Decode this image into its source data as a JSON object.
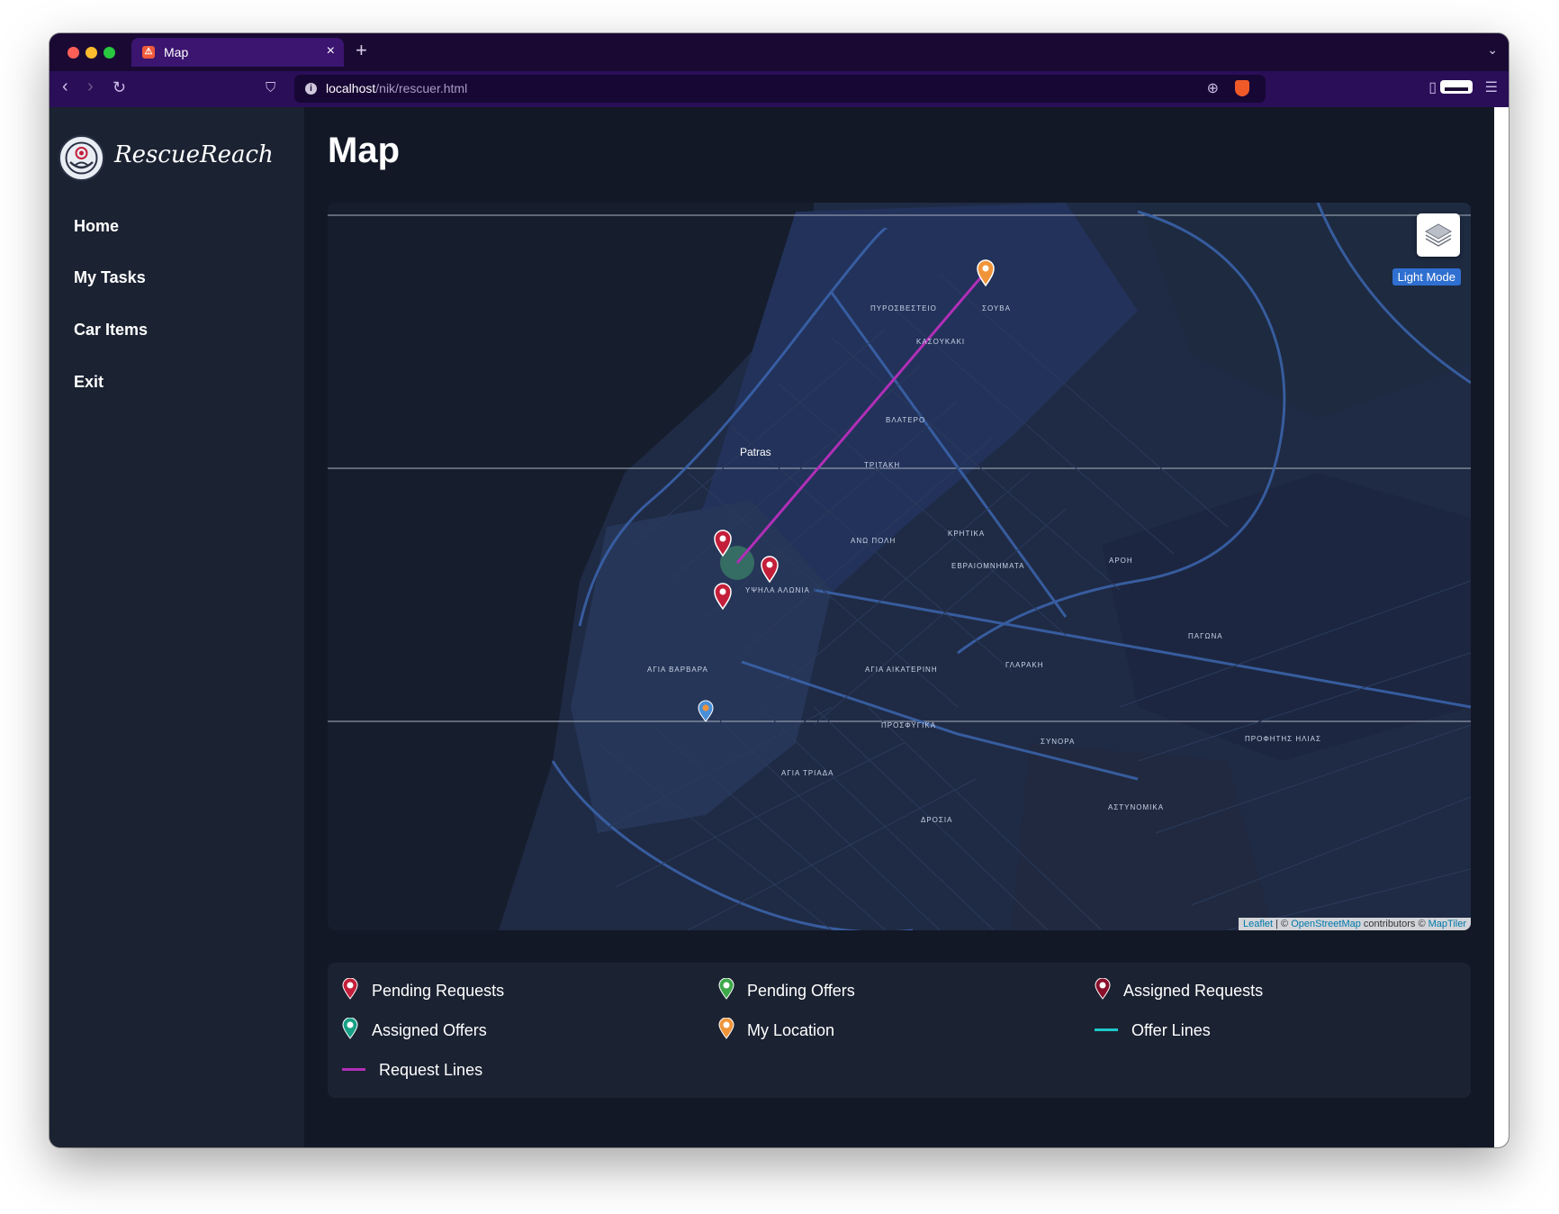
{
  "browser": {
    "tab_title": "Map",
    "url_host": "localhost",
    "url_path": "/nik/rescuer.html"
  },
  "app": {
    "logo_text": "RescueReach",
    "nav": [
      "Home",
      "My Tasks",
      "Car Items",
      "Exit"
    ]
  },
  "page": {
    "title": "Map"
  },
  "map": {
    "city_label": "Patras",
    "street_labels": [
      "ΠΥΡΟΣΒΕΣΤΕΙΟ",
      "ΣΟΥΒΑ",
      "ΚΑΣΟΥΚΑΚΙ",
      "ΒΛΑΤΕΡΟ",
      "ΤΡΙΤΑΚΗ",
      "ΑΝΩ ΠΟΛΗ",
      "ΚΡΗΤΙΚΑ",
      "ΕΒΡΑΙΟΜΝΗΜΑΤΑ",
      "ΑΡΟΗ",
      "ΥΨΗΛΑ ΑΛΩΝΙΑ",
      "ΑΓΙΑ ΒΑΡΒΑΡΑ",
      "ΑΓΙΑ ΑΙΚΑΤΕΡΙΝΗ",
      "ΓΛΑΡΑΚΗ",
      "ΠΑΓΩΝΑ",
      "ΠΡΟΣΦΥΓΙΚΑ",
      "ΑΓΙΑ ΤΡΙΑΔΑ",
      "ΣΥΝΟΡΑ",
      "ΠΡΟΦΗΤΗΣ ΗΛΙΑΣ",
      "ΑΣΤΥΝΟΜΙΚΑ",
      "ΔΡΟΣΙΑ"
    ],
    "light_mode_label": "Light Mode",
    "attribution": {
      "leaflet": "Leaflet",
      "separator": " | © ",
      "osm": "OpenStreetMap",
      "contributors": " contributors © ",
      "maptiler": "MapTiler"
    },
    "colors": {
      "request_line": "#b02fb7",
      "offer_line": "#1ec8c8",
      "pending_request": "#c41f3a",
      "pending_offer": "#3ea84a",
      "assigned_request": "#8a0f2a",
      "assigned_offer": "#16a085",
      "my_location": "#f0943a"
    }
  },
  "legend": {
    "pending_requests": "Pending Requests",
    "pending_offers": "Pending Offers",
    "assigned_requests": "Assigned Requests",
    "assigned_offers": "Assigned Offers",
    "my_location": "My Location",
    "offer_lines": "Offer Lines",
    "request_lines": "Request Lines"
  },
  "icons": [
    "map-layers-icon",
    "marker-icon",
    "bookmark-icon",
    "zoom-icon",
    "brave-shield-icon",
    "sidebar-toggle-icon",
    "menu-icon"
  ]
}
